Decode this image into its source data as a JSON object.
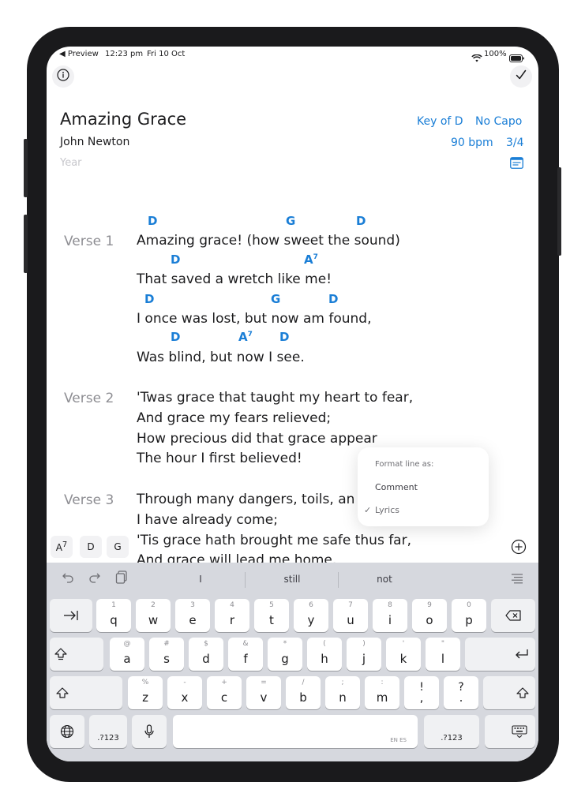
{
  "status_bar": {
    "back_app": "◀ Preview",
    "time": "12:23 pm",
    "date": "Fri 10 Oct",
    "battery": "100%"
  },
  "song": {
    "title": "Amazing Grace",
    "author": "John Newton",
    "year_placeholder": "Year",
    "key": "Key of D",
    "capo": "No Capo",
    "tempo": "90 bpm",
    "time_signature": "3/4"
  },
  "verses": [
    {
      "label": "Verse 1",
      "lines": [
        {
          "text": "Amazing grace! (how sweet the sound)",
          "chords": [
            "D",
            "G",
            "D"
          ]
        },
        {
          "text": "That saved a wretch like me!",
          "chords": [
            "D",
            "A7"
          ]
        },
        {
          "text": "I once was lost, but now am found,",
          "chords": [
            "D",
            "G",
            "D"
          ]
        },
        {
          "text": "Was blind, but now I see.",
          "chords": [
            "D",
            "A7",
            "D"
          ]
        }
      ]
    },
    {
      "label": "Verse 2",
      "lines": [
        {
          "text": "'Twas grace that taught my heart to fear,"
        },
        {
          "text": "And grace my fears relieved;"
        },
        {
          "text": "How precious did that grace appear"
        },
        {
          "text": "The hour I first believed!"
        }
      ]
    },
    {
      "label": "Verse 3",
      "lines": [
        {
          "text": "Through many dangers, toils, an"
        },
        {
          "text": "I have already come;"
        },
        {
          "text": "'Tis grace hath brought me safe thus far,"
        },
        {
          "text": "And grace will lead me home."
        }
      ]
    }
  ],
  "format_popup": {
    "heading": "Format line as:",
    "options": [
      "Comment",
      "Lyrics"
    ],
    "selected": "Lyrics",
    "check": "✓"
  },
  "chord_bar": [
    "A7",
    "D",
    "G"
  ],
  "suggestions": [
    "I",
    "still",
    "not"
  ],
  "keyboard": {
    "row1": [
      {
        "k": "q",
        "h": "1"
      },
      {
        "k": "w",
        "h": "2"
      },
      {
        "k": "e",
        "h": "3"
      },
      {
        "k": "r",
        "h": "4"
      },
      {
        "k": "t",
        "h": "5"
      },
      {
        "k": "y",
        "h": "6"
      },
      {
        "k": "u",
        "h": "7"
      },
      {
        "k": "i",
        "h": "8"
      },
      {
        "k": "o",
        "h": "9"
      },
      {
        "k": "p",
        "h": "0"
      }
    ],
    "row2": [
      {
        "k": "a",
        "h": "@"
      },
      {
        "k": "s",
        "h": "#"
      },
      {
        "k": "d",
        "h": "$"
      },
      {
        "k": "f",
        "h": "&"
      },
      {
        "k": "g",
        "h": "*"
      },
      {
        "k": "h",
        "h": "("
      },
      {
        "k": "j",
        "h": ")"
      },
      {
        "k": "k",
        "h": "'"
      },
      {
        "k": "l",
        "h": "\""
      }
    ],
    "row3": [
      {
        "k": "z",
        "h": "%"
      },
      {
        "k": "x",
        "h": "-"
      },
      {
        "k": "c",
        "h": "+"
      },
      {
        "k": "v",
        "h": "="
      },
      {
        "k": "b",
        "h": "/"
      },
      {
        "k": "n",
        "h": ";"
      },
      {
        "k": "m",
        "h": ":"
      },
      {
        "k": ",",
        "h": "!"
      },
      {
        "k": ".",
        "h": "?"
      }
    ],
    "numbers_label": ".?123",
    "space_label": "EN ES"
  }
}
